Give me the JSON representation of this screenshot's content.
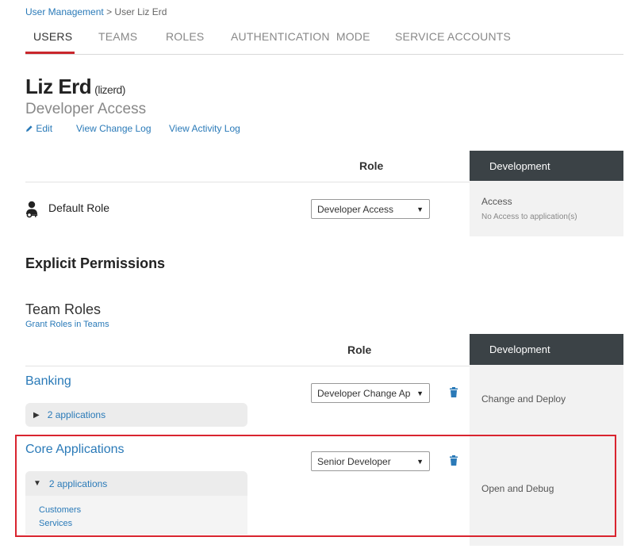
{
  "breadcrumb": {
    "parent": "User Management",
    "separator": ">",
    "current": "User Liz Erd"
  },
  "tabs": [
    {
      "label": "USERS",
      "active": true
    },
    {
      "label": "TEAMS",
      "active": false
    },
    {
      "label": "ROLES",
      "active": false
    },
    {
      "label": "AUTHENTICATION  MODE",
      "active": false
    },
    {
      "label": "SERVICE ACCOUNTS",
      "active": false
    }
  ],
  "user": {
    "display_name": "Liz Erd",
    "username": "(lizerd)",
    "access_role": "Developer Access",
    "actions": {
      "edit": "Edit",
      "change_log": "View Change Log",
      "activity_log": "View Activity Log"
    }
  },
  "default_section": {
    "role_header": "Role",
    "env_header": "Development",
    "row": {
      "icon": "user-key-icon",
      "label": "Default Role",
      "role_value": "Developer Access",
      "access_label": "Access",
      "access_detail": "No Access to application(s)"
    }
  },
  "explicit_permissions": {
    "title": "Explicit Permissions"
  },
  "team_roles": {
    "title": "Team Roles",
    "grant_link": "Grant Roles in Teams",
    "role_header": "Role",
    "env_header": "Development",
    "teams": [
      {
        "name": "Banking",
        "apps_label": "2 applications",
        "expanded": false,
        "role_value": "Developer Change Ap",
        "permission": "Change and Deploy"
      },
      {
        "name": "Core Applications",
        "apps_label": "2 applications",
        "expanded": true,
        "apps": [
          "Customers",
          "Services"
        ],
        "role_value": "Senior Developer",
        "permission": "Open and Debug"
      }
    ]
  },
  "colors": {
    "accent": "#c9262c",
    "link": "#2a7ab8",
    "header_dark": "#3b4246",
    "highlight": "#d9242f"
  }
}
